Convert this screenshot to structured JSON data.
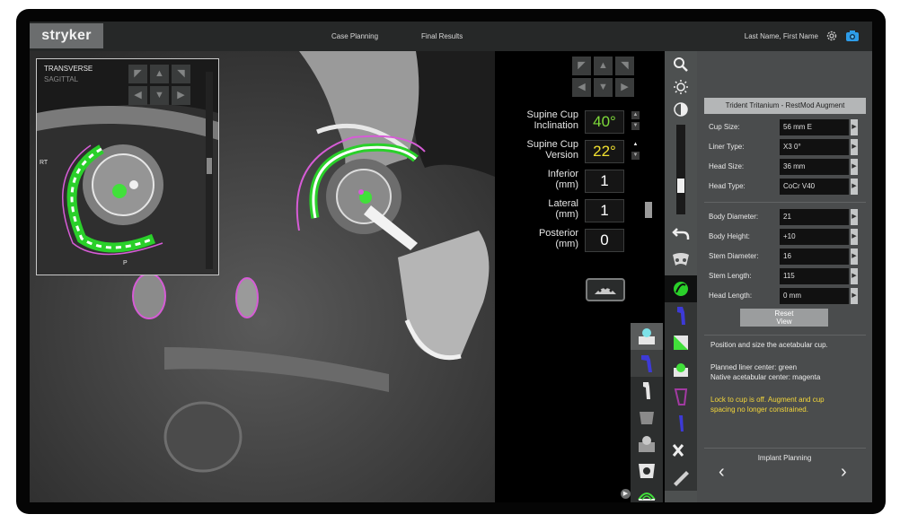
{
  "app": {
    "logo": "stryker",
    "user": "Last Name, First Name"
  },
  "nav": {
    "tabs": [
      {
        "label": "Case Planning"
      },
      {
        "label": "Final Results"
      }
    ]
  },
  "inset": {
    "view_active": "TRANSVERSE",
    "view_inactive": "SAGITTAL",
    "side": "RT",
    "marker": "P"
  },
  "params": [
    {
      "label_line1": "Supine Cup",
      "label_line2": "Inclination",
      "value": "40°",
      "color": "#7edb3a"
    },
    {
      "label_line1": "Supine Cup",
      "label_line2": "Version",
      "value": "22°",
      "color": "#f0e030"
    },
    {
      "label_line1": "Inferior",
      "label_line2": "(mm)",
      "value": "1",
      "color": "#ffffff"
    },
    {
      "label_line1": "Lateral",
      "label_line2": "(mm)",
      "value": "1",
      "color": "#ffffff"
    },
    {
      "label_line1": "Posterior",
      "label_line2": "(mm)",
      "value": "0",
      "color": "#ffffff"
    }
  ],
  "panel": {
    "title": "Trident Tritanium - RestMod Augment",
    "fields": [
      {
        "label": "Cup Size:",
        "value": "56 mm E"
      },
      {
        "label": "Liner Type:",
        "value": "X3 0°"
      },
      {
        "label": "Head Size:",
        "value": "36 mm"
      },
      {
        "label": "Head Type:",
        "value": "CoCr V40"
      },
      {
        "label": "Body Diameter:",
        "value": "21"
      },
      {
        "label": "Body Height:",
        "value": "+10"
      },
      {
        "label": "Stem Diameter:",
        "value": "16"
      },
      {
        "label": "Stem Length:",
        "value": "115"
      },
      {
        "label": "Head Length:",
        "value": "0 mm"
      }
    ],
    "reset_label_line1": "Reset",
    "reset_label_line2": "View",
    "info1": "Position and size the acetabular cup.",
    "info2": "Planned liner center: green",
    "info3": "Native acetabular center: magenta",
    "warning_line1": "Lock to cup is off. Augment and cup",
    "warning_line2": "spacing no longer constrained.",
    "nav_label": "Implant Planning",
    "nav_prev": "‹",
    "nav_next": "›"
  },
  "colors": {
    "accent_green": "#41e03a",
    "magenta": "#d65cd6",
    "warning": "#f3d63a",
    "panel_bg": "#4a4c4d"
  },
  "icons": [
    "settings-gear-icon",
    "camera-icon",
    "zoom-icon",
    "brightness-icon",
    "contrast-icon",
    "undo-icon",
    "pelvis-icon",
    "cup-icon",
    "stem-icon",
    "ruler-icon"
  ]
}
